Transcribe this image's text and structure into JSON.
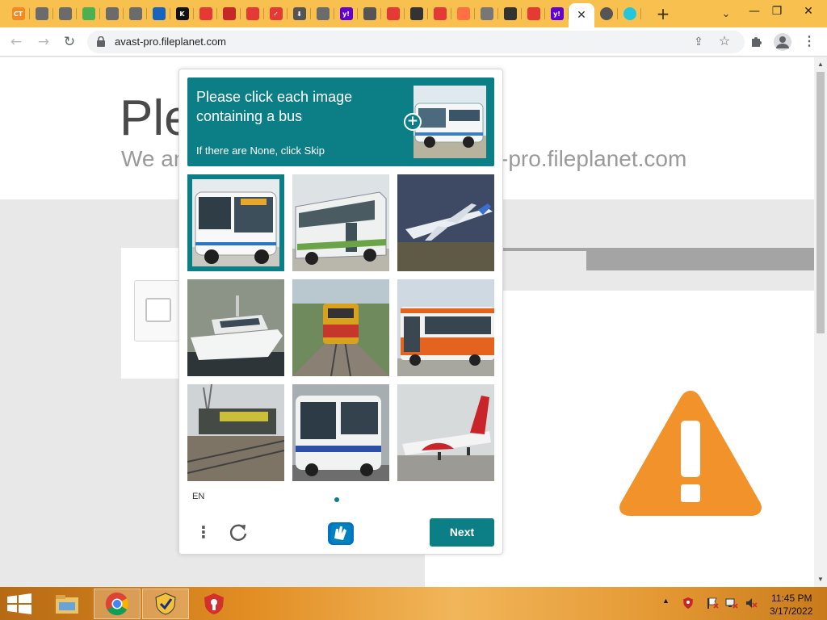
{
  "browser": {
    "tabs": [
      {
        "icon": "ct-icon",
        "label": "CT",
        "color": "#f08a24"
      },
      {
        "icon": "globe-icon",
        "label": "",
        "color": "#6b6b6b"
      },
      {
        "icon": "globe-icon",
        "label": "",
        "color": "#6b6b6b"
      },
      {
        "icon": "leaf-icon",
        "label": "",
        "color": "#4caf50"
      },
      {
        "icon": "globe-icon",
        "label": "",
        "color": "#6b6b6b"
      },
      {
        "icon": "globe-icon",
        "label": "",
        "color": "#6b6b6b"
      },
      {
        "icon": "shield-blue-icon",
        "label": "",
        "color": "#1565c0"
      },
      {
        "icon": "k-icon",
        "label": "K",
        "color": "#111111"
      },
      {
        "icon": "box-icon",
        "label": "",
        "color": "#e53935"
      },
      {
        "icon": "jet-icon",
        "label": "",
        "color": "#c62828"
      },
      {
        "icon": "red-badge-icon",
        "label": "",
        "color": "#e53935"
      },
      {
        "icon": "check-red-icon",
        "label": "✓",
        "color": "#e53935"
      },
      {
        "icon": "download-icon",
        "label": "⬇",
        "color": "#555555"
      },
      {
        "icon": "globe-icon",
        "label": "",
        "color": "#6b6b6b"
      },
      {
        "icon": "yahoo-icon",
        "label": "y!",
        "color": "#6001d2"
      },
      {
        "icon": "search-icon",
        "label": "",
        "color": "#555555"
      },
      {
        "icon": "shield-red-icon",
        "label": "",
        "color": "#e53935"
      },
      {
        "icon": "clock-icon",
        "label": "",
        "color": "#333333"
      },
      {
        "icon": "shield-x-icon",
        "label": "",
        "color": "#e53935"
      },
      {
        "icon": "rainbow-icon",
        "label": "",
        "color": "#ff7043"
      },
      {
        "icon": "shield-check-icon",
        "label": "",
        "color": "#777777"
      },
      {
        "icon": "avatar-icon",
        "label": "",
        "color": "#333333"
      },
      {
        "icon": "shield-x-icon",
        "label": "",
        "color": "#e53935"
      },
      {
        "icon": "yahoo-icon",
        "label": "y!",
        "color": "#6001d2"
      }
    ],
    "active_tab_close": "✕",
    "after_tabs": [
      {
        "icon": "search-icon",
        "color": "#555555"
      },
      {
        "icon": "diamond-icon",
        "color": "#26c6da"
      }
    ],
    "new_tab": "+",
    "tab_search": "⌄",
    "window": {
      "minimize": "—",
      "restore": "❐",
      "close": "✕"
    },
    "url": "avast-pro.fileplanet.com"
  },
  "page": {
    "title": "Ple",
    "subtitle_left": "We ar",
    "subtitle_right": "-pro.fileplanet.com"
  },
  "captcha": {
    "prompt": "Please click each image containing a bus",
    "skip_hint": "If there are None, click Skip",
    "expand": "+",
    "language": "EN",
    "menu": "⋮",
    "next_label": "Next",
    "accent": "#0c7f86",
    "tiles": [
      {
        "subject": "bus",
        "selected": true
      },
      {
        "subject": "bus",
        "selected": false
      },
      {
        "subject": "airplane",
        "selected": false
      },
      {
        "subject": "boat",
        "selected": false
      },
      {
        "subject": "train",
        "selected": false
      },
      {
        "subject": "bus",
        "selected": false
      },
      {
        "subject": "train",
        "selected": false
      },
      {
        "subject": "bus",
        "selected": false
      },
      {
        "subject": "airplane",
        "selected": false
      }
    ]
  },
  "taskbar": {
    "apps": [
      "file-explorer-icon",
      "chrome-icon",
      "norton-icon",
      "shield-app-icon"
    ],
    "time": "11:45 PM",
    "date": "3/17/2022",
    "tray_up": "▲"
  }
}
